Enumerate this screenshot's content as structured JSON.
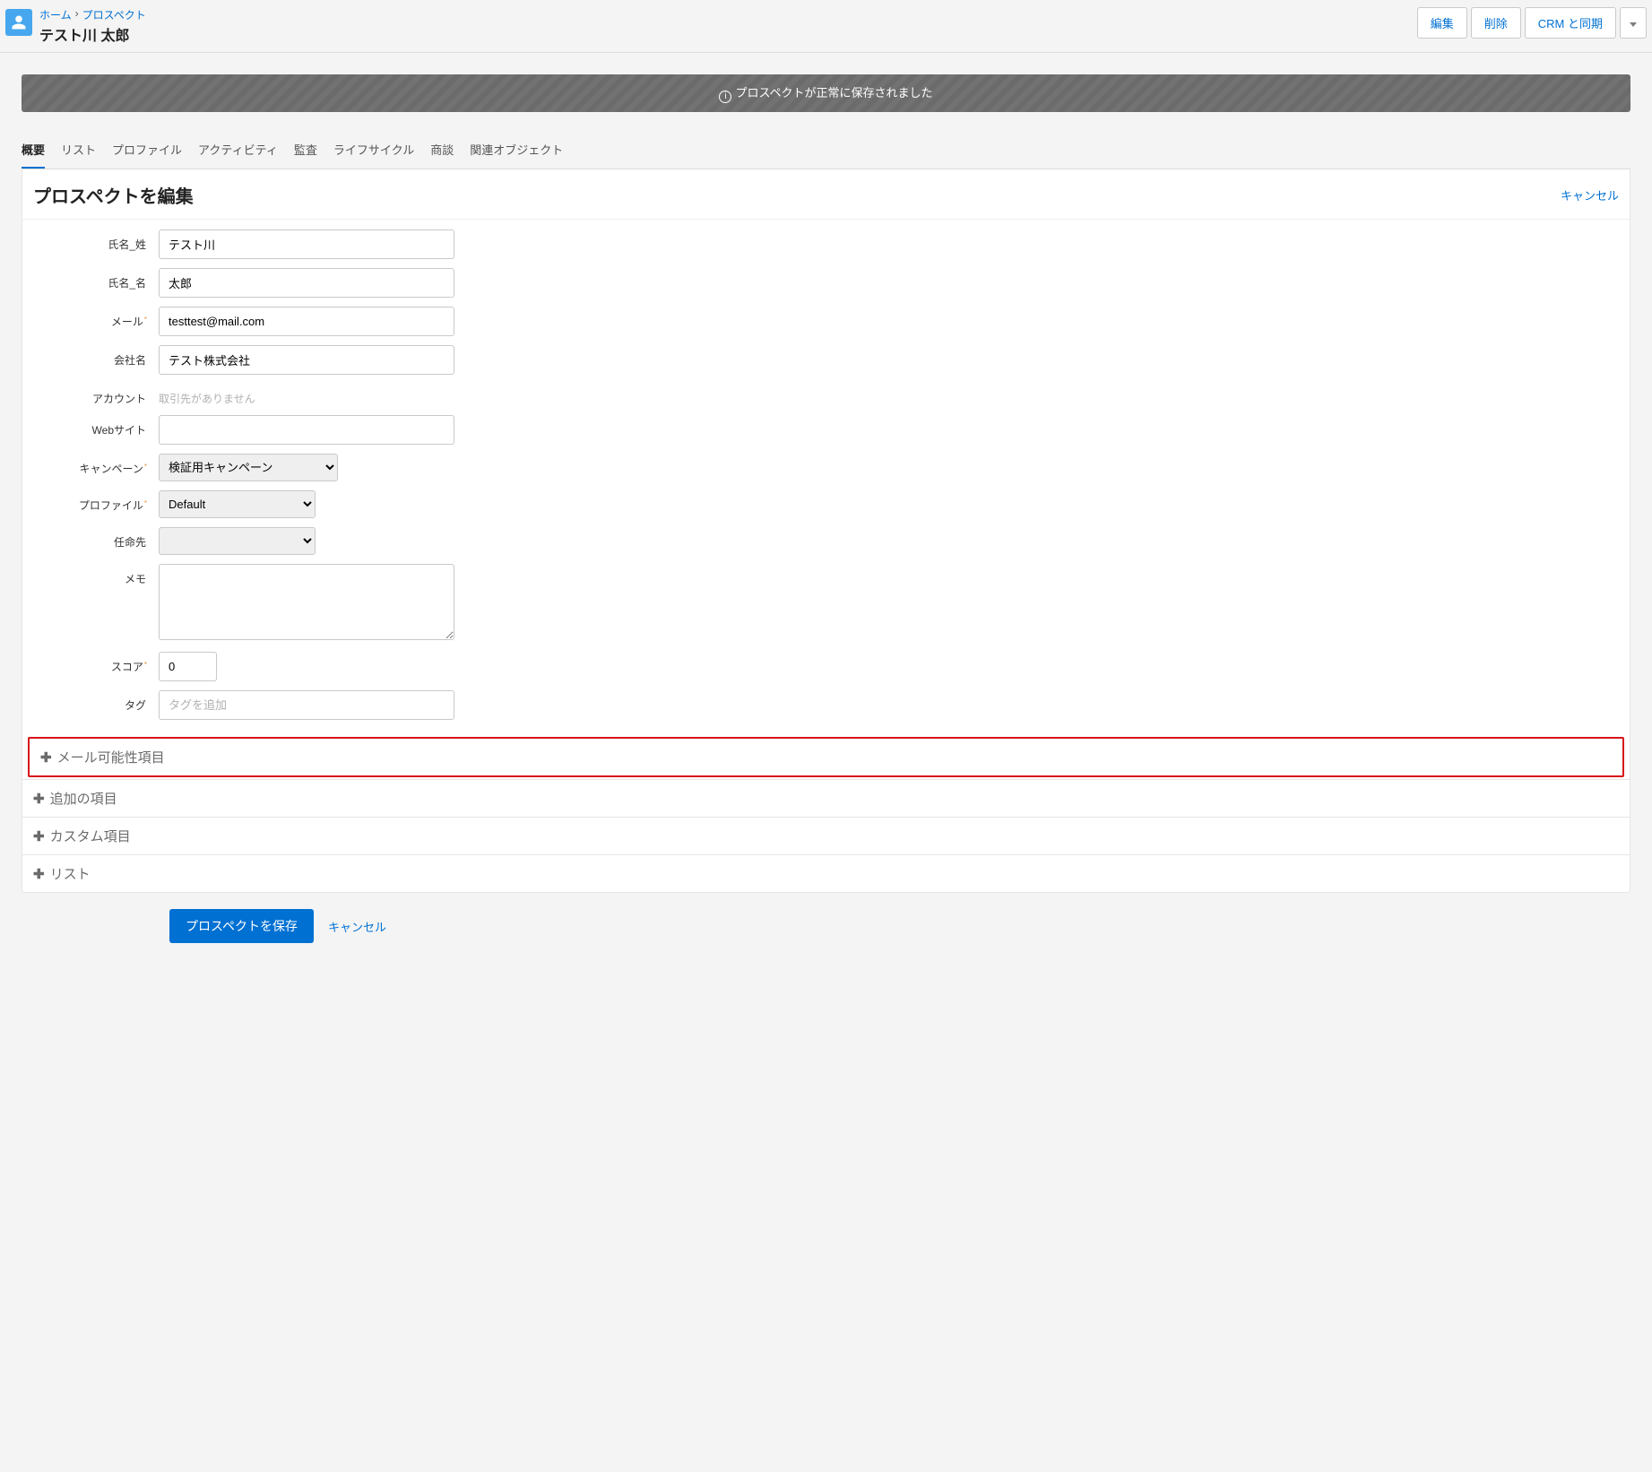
{
  "breadcrumb": {
    "home": "ホーム",
    "prospect": "プロスペクト"
  },
  "page_title": "テスト川 太郎",
  "header_buttons": {
    "edit": "編集",
    "delete": "削除",
    "crm_sync": "CRM と同期"
  },
  "alert": "プロスペクトが正常に保存されました",
  "tabs": {
    "items": [
      "概要",
      "リスト",
      "プロファイル",
      "アクティビティ",
      "監査",
      "ライフサイクル",
      "商談",
      "関連オブジェクト"
    ]
  },
  "panel": {
    "title": "プロスペクトを編集",
    "cancel": "キャンセル"
  },
  "form": {
    "last_name": {
      "label": "氏名_姓",
      "value": "テスト川"
    },
    "first_name": {
      "label": "氏名_名",
      "value": "太郎"
    },
    "email": {
      "label": "メール",
      "value": "testtest@mail.com"
    },
    "company": {
      "label": "会社名",
      "value": "テスト株式会社"
    },
    "account": {
      "label": "アカウント",
      "static": "取引先がありません"
    },
    "website": {
      "label": "Webサイト",
      "value": ""
    },
    "campaign": {
      "label": "キャンペーン",
      "selected": "検証用キャンペーン"
    },
    "profile": {
      "label": "プロファイル",
      "selected": "Default"
    },
    "assignee": {
      "label": "任命先",
      "selected": ""
    },
    "memo": {
      "label": "メモ",
      "value": ""
    },
    "score": {
      "label": "スコア",
      "value": "0"
    },
    "tag": {
      "label": "タグ",
      "placeholder": "タグを追加"
    }
  },
  "accordions": {
    "mailability": "メール可能性項目",
    "additional": "追加の項目",
    "custom": "カスタム項目",
    "list": "リスト"
  },
  "footer": {
    "save": "プロスペクトを保存",
    "cancel": "キャンセル"
  }
}
